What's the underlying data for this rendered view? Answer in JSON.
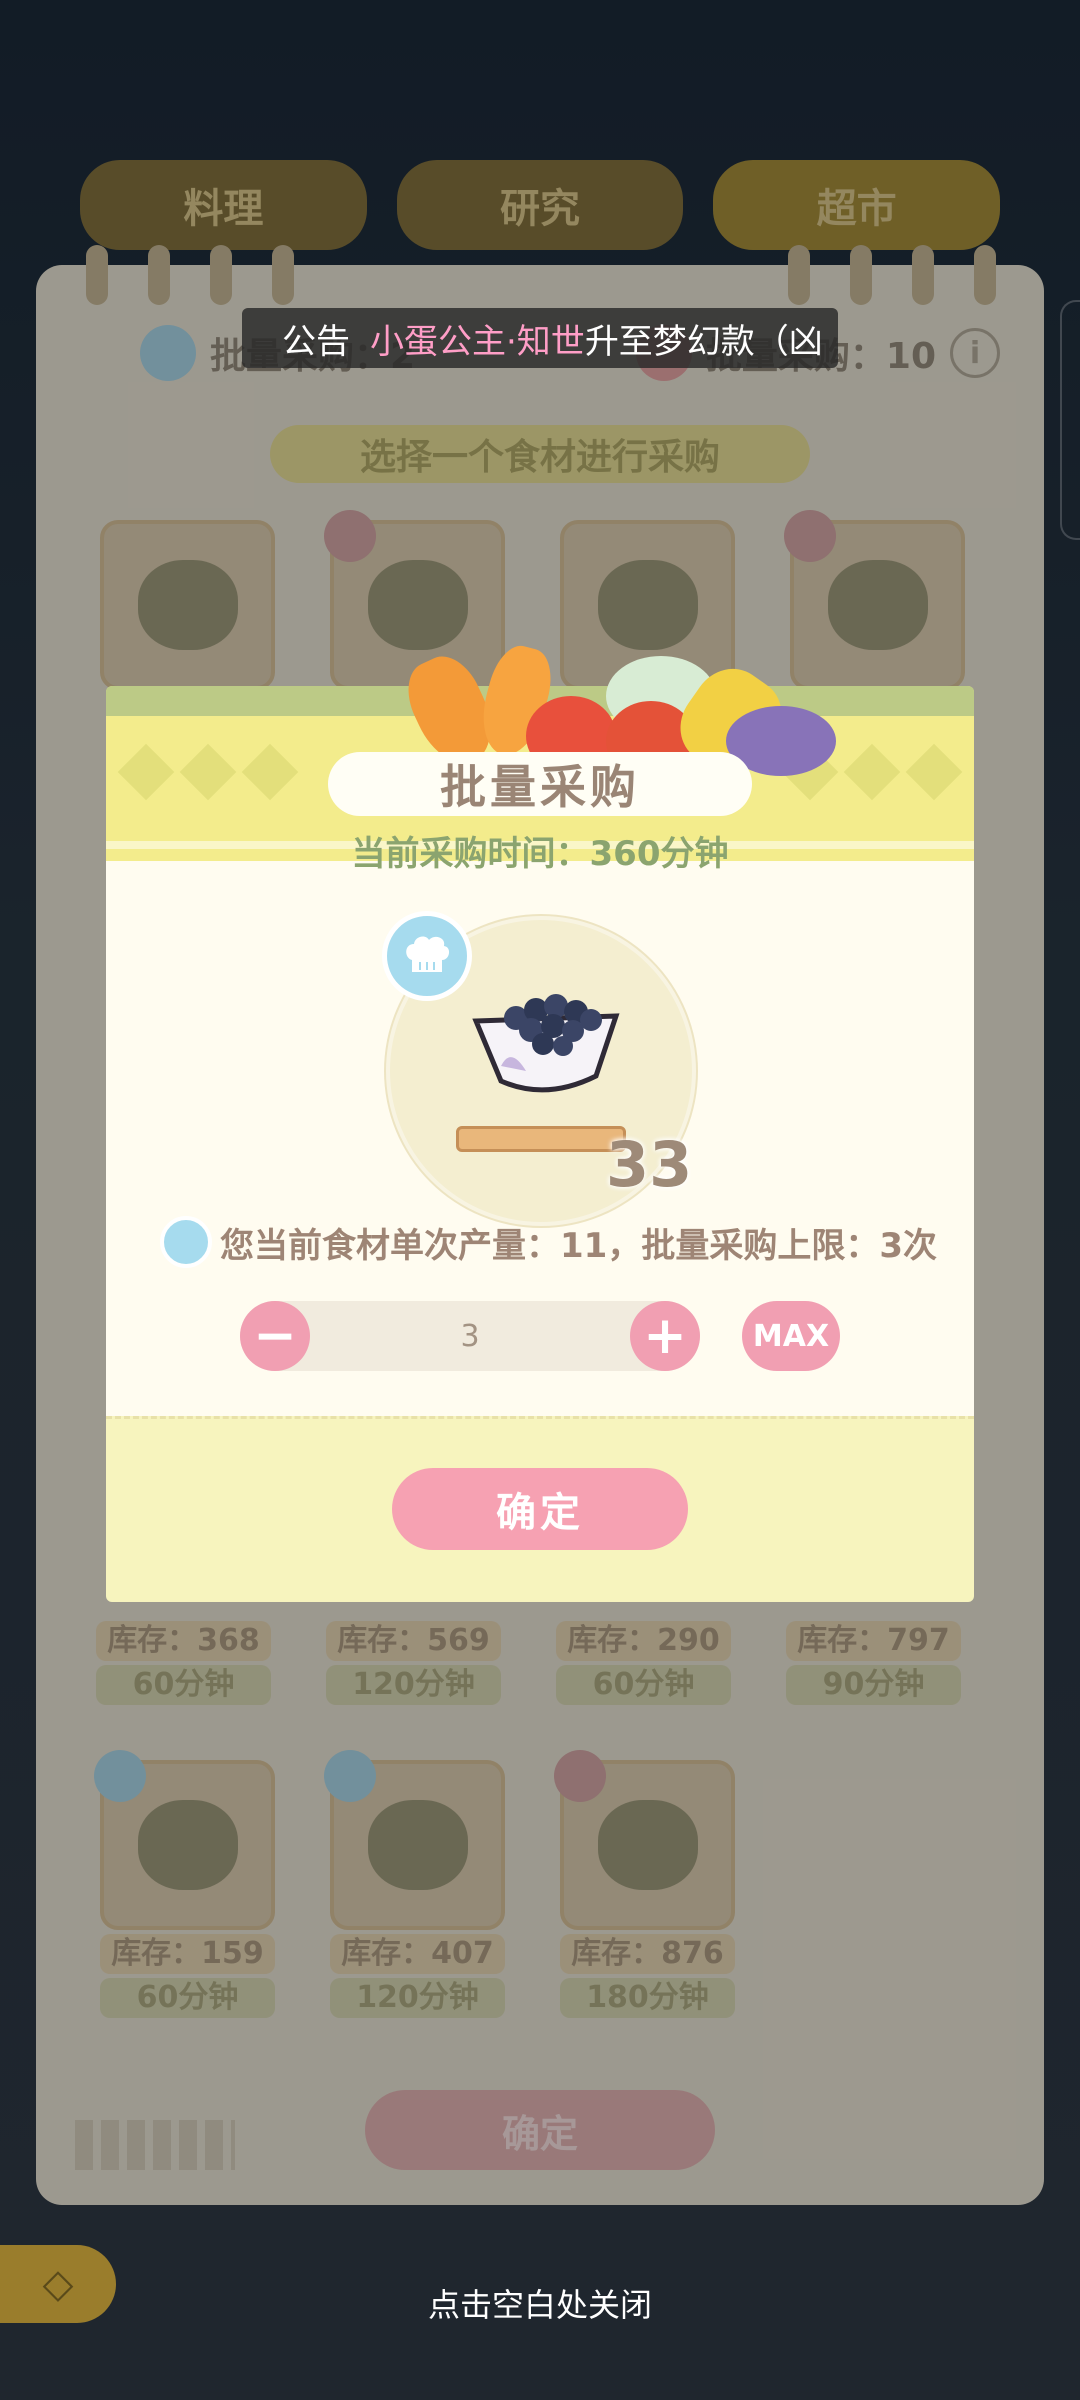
{
  "top_tabs": [
    "料理",
    "研究",
    "超市"
  ],
  "announcement": {
    "prefix": "公告",
    "highlight": "小蛋公主·知世",
    "text": "升至梦幻款（凶"
  },
  "info_bar": {
    "batch_left": "批量采购：2",
    "batch_right": "批量采购：10",
    "info_icon": "i"
  },
  "select_banner": "选择一个食材进行采购",
  "cards": [
    {
      "stock": "库存：368",
      "time": "60分钟"
    },
    {
      "stock": "库存：569",
      "time": "120分钟"
    },
    {
      "stock": "库存：290",
      "time": "60分钟"
    },
    {
      "stock": "库存：797",
      "time": "90分钟"
    },
    {
      "stock": "库存：159",
      "time": "60分钟"
    },
    {
      "stock": "库存：407",
      "time": "120分钟"
    },
    {
      "stock": "库存：876",
      "time": "180分钟"
    }
  ],
  "bg_confirm": "确定",
  "dialog": {
    "title": "批量采购",
    "time_text": "当前采购时间：360分钟",
    "item_count": "33",
    "yield_text": "您当前食材单次产量：11，批量采购上限：3次",
    "quantity": "3",
    "minus_label": "−",
    "plus_label": "+",
    "max_label": "MAX",
    "confirm_label": "确定"
  },
  "close_hint": "点击空白处关闭",
  "colors": {
    "pink_button": "#f6a1b2",
    "title_green": "#8ba46f",
    "header_yellow": "#f3ec8c"
  }
}
